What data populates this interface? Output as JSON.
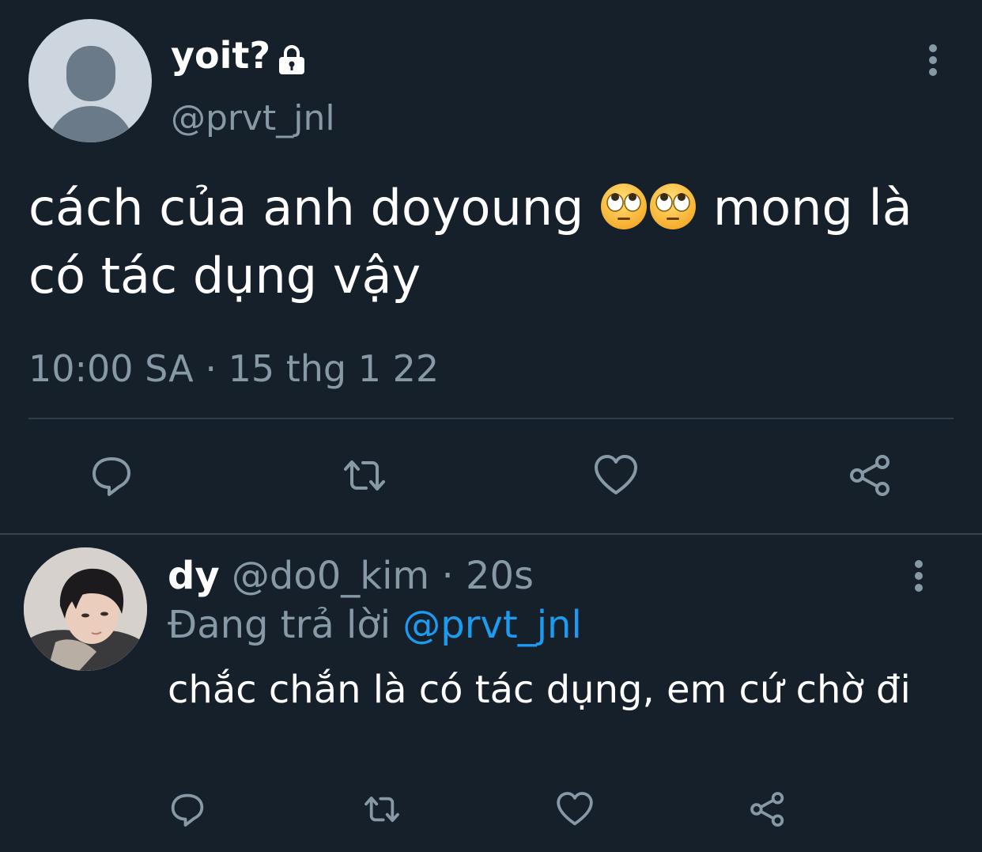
{
  "tweet": {
    "author": {
      "display_name": "yoit?",
      "handle": "@prvt_jnl",
      "avatar": "default-avatar",
      "protected_icon": "lock-icon"
    },
    "text_before_emoji": "cách của anh doyoung ",
    "emojis": [
      "face-with-rolling-eyes",
      "face-with-rolling-eyes"
    ],
    "text_after_emoji": " mong là có tác dụng vậy",
    "timestamp": "10:00 SA · 15 thg 1 22",
    "actions": [
      "reply-icon",
      "retweet-icon",
      "like-icon",
      "share-icon"
    ],
    "more_icon": "more-vertical-icon"
  },
  "reply": {
    "author": {
      "display_name": "dy",
      "handle": "@do0_kim",
      "time": "· 20s",
      "avatar": "profile-photo"
    },
    "replying_prefix": "Đang trả lời ",
    "replying_to": "@prvt_jnl",
    "text": "chắc chắn là có tác dụng, em cứ chờ đi",
    "actions": [
      "reply-icon",
      "retweet-icon",
      "like-icon",
      "share-icon"
    ],
    "more_icon": "more-vertical-icon"
  },
  "colors": {
    "background": "#15202b",
    "primary_text": "#ffffff",
    "secondary_text": "#8899a6",
    "link": "#1d9bf0",
    "divider": "#38444d"
  }
}
